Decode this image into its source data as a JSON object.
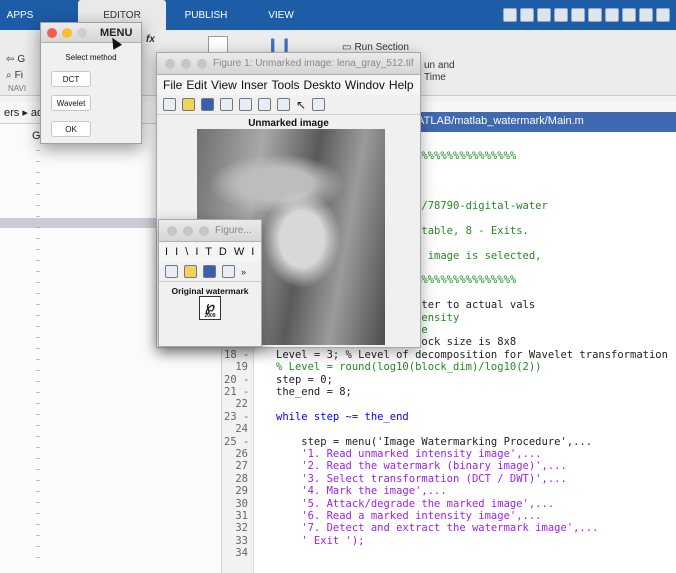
{
  "tabs": [
    "APPS",
    "EDITOR",
    "PUBLISH",
    "VIEW"
  ],
  "ribbon": {
    "run_section": "Run Section",
    "run_and_time_1": "un and",
    "run_and_time_2": "Time",
    "navigate": "NAVI",
    "go_partial": "G",
    "find_partial": "Fi",
    "fx": "fx"
  },
  "path_partial": "ers ▸ ad",
  "left_panel_partial": "G",
  "editor": {
    "file_path": "MATLAB/matlab_watermark/Main.m",
    "lines": [
      {
        "n": "",
        "text": "es",
        "cls": "cm"
      },
      {
        "n": "",
        "text": "%%%%%%%%%%%%%%%%%%%%%%%%%%%%%%%%%%%%%%",
        "cls": "cm"
      },
      {
        "n": "",
        "text": ": 2021",
        "cls": "cm"
      },
      {
        "n": "",
        "text": "",
        "cls": ""
      },
      {
        "n": "",
        "text": "ovac/watermark",
        "cls": "cm"
      },
      {
        "n": "",
        "text": "labcentral/fileexchange/78790-digital-water",
        "cls": "cm"
      },
      {
        "n": "",
        "text": "l the program flow:",
        "cls": "cm"
      },
      {
        "n": "",
        "text": "it, steps 3-7 are repeatable, 8 - Exits.",
        "cls": "cm"
      },
      {
        "n": "",
        "text": "",
        "cls": ""
      },
      {
        "n": "",
        "text": "e grayscale. If a color image is selected,",
        "cls": "cm"
      },
      {
        "n": "",
        "text": " image.",
        "cls": "cm"
      },
      {
        "n": "",
        "text": "%%%%%%%%%%%%%%%%%%%%%%%%%%%%%%%%%%%%%%",
        "cls": "cm"
      },
      {
        "n": "",
        "text": "",
        "cls": ""
      },
      {
        "n": "",
        "text": "dim_wmark = 1; % set later to actual vals",
        "cls": ""
      },
      {
        "n": "",
        "text": "h\" in [%] of coeffs intensity",
        "cls": "cm"
      },
      {
        "n": "",
        "text": "tion coefficients change",
        "cls": "cm"
      },
      {
        "n": "17 -",
        "text": "block_dim = 8; % DCT block size is 8x8",
        "cls": ""
      },
      {
        "n": "18 -",
        "text": "Level = 3; % Level of decomposition for Wavelet transformation",
        "cls": ""
      },
      {
        "n": "19",
        "text": "% Level = round(log10(block_dim)/log10(2))",
        "cls": "cm"
      },
      {
        "n": "20 -",
        "text": "step = 0;",
        "cls": ""
      },
      {
        "n": "21 -",
        "text": "the_end = 8;",
        "cls": ""
      },
      {
        "n": "22",
        "text": "",
        "cls": ""
      },
      {
        "n": "23 -",
        "text": "while step ~= the_end",
        "cls": "kw"
      },
      {
        "n": "24",
        "text": "",
        "cls": ""
      },
      {
        "n": "25 -",
        "text": "    step = menu('Image Watermarking Procedure',...",
        "cls": ""
      },
      {
        "n": "26",
        "text": "    '1. Read unmarked intensity image',...",
        "cls": "str"
      },
      {
        "n": "27",
        "text": "    '2. Read the watermark (binary image)',...",
        "cls": "str"
      },
      {
        "n": "28",
        "text": "    '3. Select transformation (DCT / DWT)',...",
        "cls": "str"
      },
      {
        "n": "29",
        "text": "    '4. Mark the image',...",
        "cls": "str"
      },
      {
        "n": "30",
        "text": "    '5. Attack/degrade the marked image',...",
        "cls": "str"
      },
      {
        "n": "31",
        "text": "    '6. Read a marked intensity image',...",
        "cls": "str"
      },
      {
        "n": "32",
        "text": "    '7. Detect and extract the watermark image',...",
        "cls": "str"
      },
      {
        "n": "33",
        "text": "    ' Exit ');",
        "cls": "str"
      },
      {
        "n": "34",
        "text": "",
        "cls": ""
      }
    ]
  },
  "figure1": {
    "title": "Figure 1: Unmarked image: lena_gray_512.tif",
    "menu": [
      "File",
      "Edit",
      "View",
      "Inser",
      "Tools",
      "Deskto",
      "Windov",
      "Help"
    ],
    "axes_title": "Unmarked image"
  },
  "figure2": {
    "title": "Figure...",
    "menu": "I I \\ I T D W I",
    "axes_title": "Original watermark",
    "wm_year": "2009"
  },
  "menu_dialog": {
    "title": "MENU",
    "label": "Select method",
    "buttons": [
      "DCT",
      "Wavelet",
      "OK"
    ]
  }
}
